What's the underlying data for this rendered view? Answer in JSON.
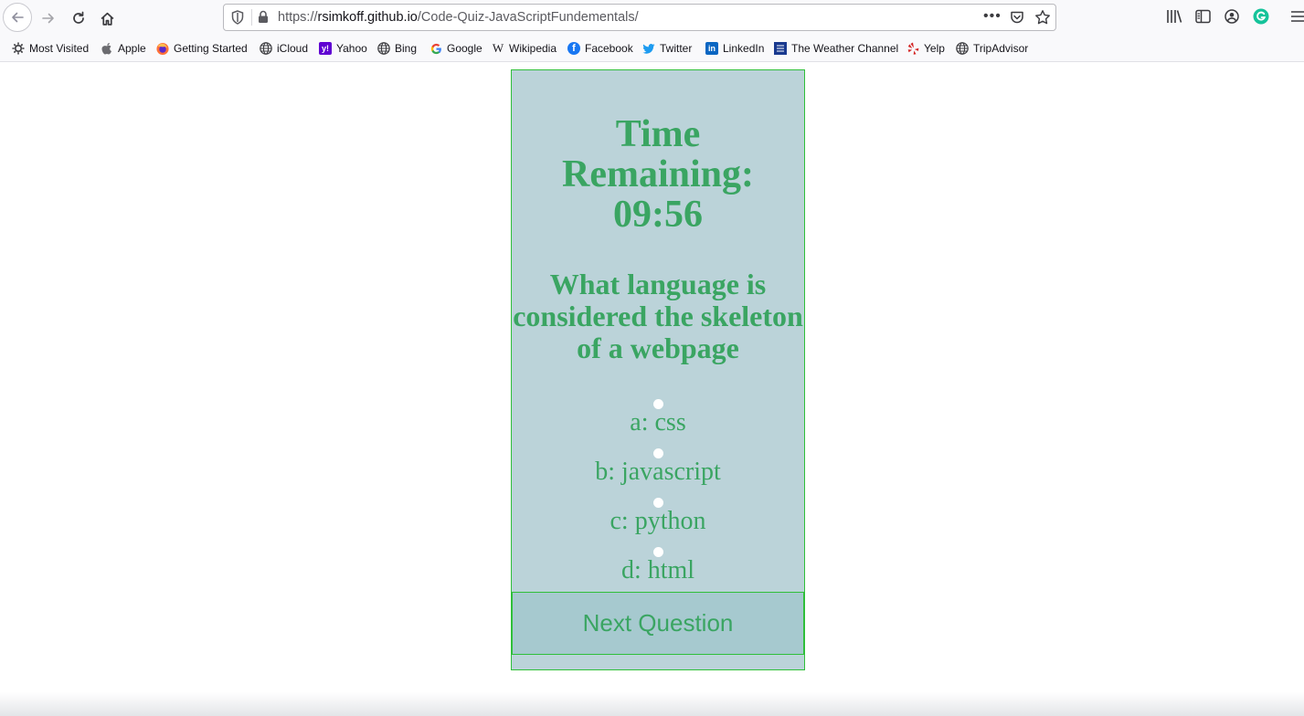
{
  "browser": {
    "url_host_prefix": "https://",
    "url_host": "rsimkoff.github.io",
    "url_path": "/Code-Quiz-JavaScriptFundementals/",
    "url_more": "•••",
    "bookmarks": [
      {
        "label": "Most Visited",
        "icon": "gear-icon"
      },
      {
        "label": "Apple",
        "icon": "apple-icon"
      },
      {
        "label": "Getting Started",
        "icon": "firefox-icon"
      },
      {
        "label": "iCloud",
        "icon": "globe-icon"
      },
      {
        "label": "Yahoo",
        "icon": "yahoo-icon"
      },
      {
        "label": "Bing",
        "icon": "globe-icon"
      },
      {
        "label": "Google",
        "icon": "google-icon"
      },
      {
        "label": "Wikipedia",
        "icon": "wikipedia-icon"
      },
      {
        "label": "Facebook",
        "icon": "facebook-icon"
      },
      {
        "label": "Twitter",
        "icon": "twitter-icon"
      },
      {
        "label": "LinkedIn",
        "icon": "linkedin-icon"
      },
      {
        "label": "The Weather Channel",
        "icon": "weather-channel-icon"
      },
      {
        "label": "Yelp",
        "icon": "yelp-icon"
      },
      {
        "label": "TripAdvisor",
        "icon": "globe-icon"
      }
    ]
  },
  "quiz": {
    "timer_line1": "Time",
    "timer_line2": "Remaining:",
    "timer_value": "09:56",
    "question": "What language is considered the skeleton of a webpage",
    "choices": [
      {
        "label": "a: css"
      },
      {
        "label": "b: javascript"
      },
      {
        "label": "c: python"
      },
      {
        "label": "d: html"
      }
    ],
    "next_button": "Next Question"
  },
  "colors": {
    "card_background": "#bbd3d9",
    "card_border": "#2fbf3a",
    "text_green": "#3aa562",
    "button_background": "#a6c9cf"
  }
}
